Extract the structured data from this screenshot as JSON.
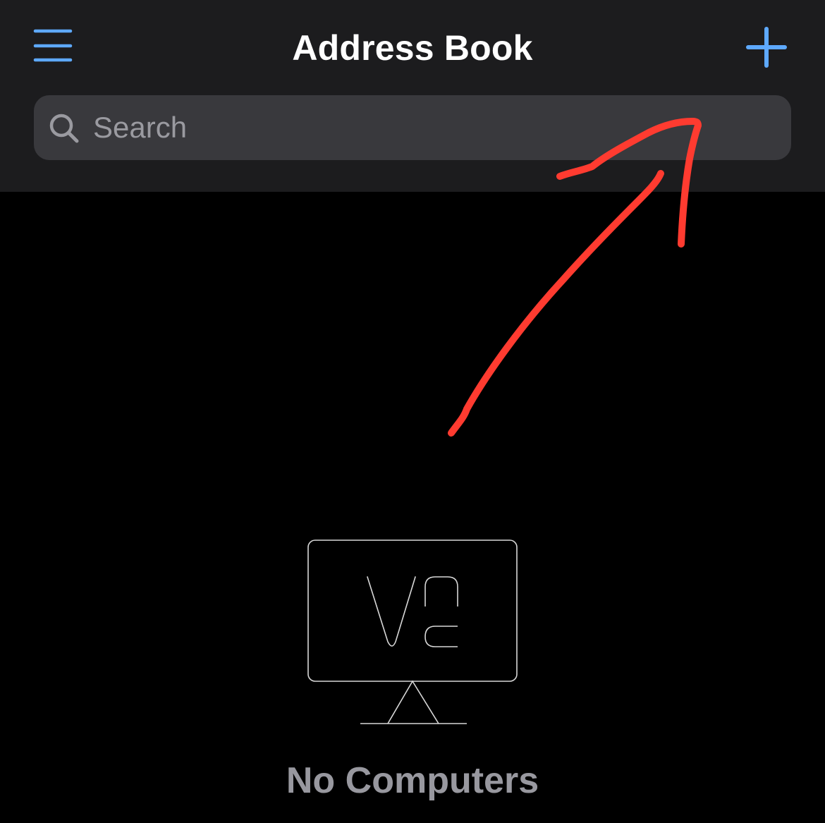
{
  "nav": {
    "title": "Address Book",
    "menu_icon": "hamburger-menu-icon",
    "add_icon": "plus-icon"
  },
  "search": {
    "placeholder": "Search",
    "value": "",
    "icon": "magnifying-glass-icon"
  },
  "empty_state": {
    "icon": "vnc-computer-icon",
    "label": "No Computers"
  },
  "colors": {
    "accent": "#5ea9ff",
    "nav_background": "#1c1c1e",
    "search_background": "#39393d",
    "page_background": "#000000",
    "annotation": "#ff3b30"
  },
  "annotation": {
    "type": "arrow",
    "points_to": "search-bar"
  }
}
